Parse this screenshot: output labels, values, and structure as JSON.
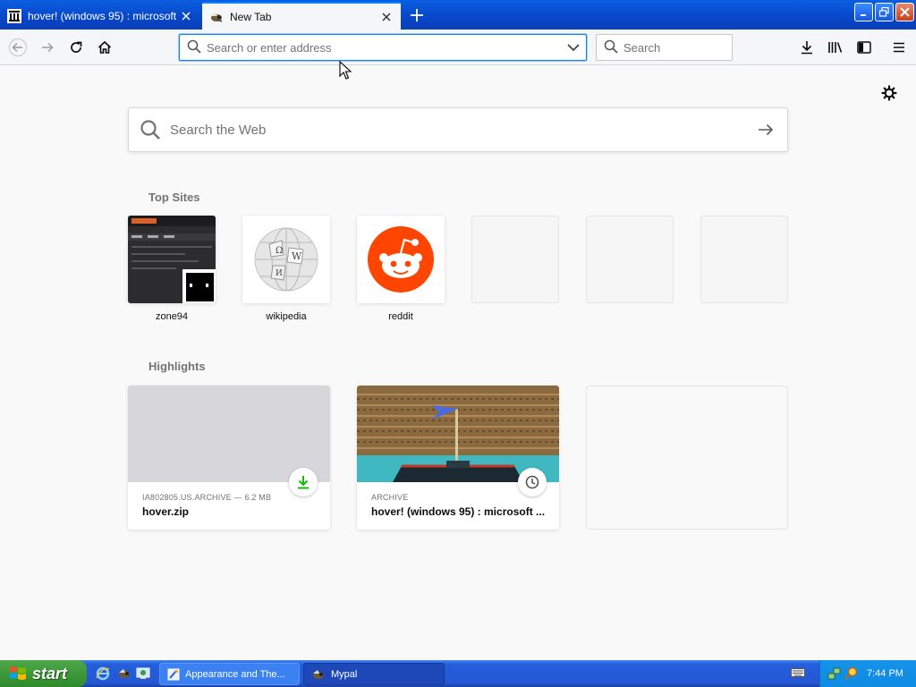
{
  "tabs": [
    {
      "title": "hover! (windows 95) : microsoft :",
      "icon": "archive-icon",
      "active": false
    },
    {
      "title": "New Tab",
      "icon": "mypal-icon",
      "active": true
    }
  ],
  "window_controls": [
    "minimize",
    "maximize",
    "close"
  ],
  "navbar": {
    "url_placeholder": "Search or enter address",
    "url_value": "",
    "search_placeholder": "Search"
  },
  "newtab": {
    "web_search_placeholder": "Search the Web",
    "top_sites_title": "Top Sites",
    "highlights_title": "Highlights",
    "top_sites": [
      {
        "label": "zone94",
        "thumb": "screenshot"
      },
      {
        "label": "wikipedia",
        "thumb": "wikipedia-globe-icon"
      },
      {
        "label": "reddit",
        "thumb": "reddit-alien-icon"
      },
      {
        "label": "",
        "thumb": "empty"
      },
      {
        "label": "",
        "thumb": "empty"
      },
      {
        "label": "",
        "thumb": "empty"
      }
    ],
    "highlights": [
      {
        "context": "IA802805.US.ARCHIVE — 6.2 MB",
        "title": "hover.zip",
        "badge": "download-icon"
      },
      {
        "context": "ARCHIVE",
        "title": "hover! (windows 95) : microsoft ...",
        "badge": "history-clock-icon"
      },
      {
        "context": "",
        "title": "",
        "badge": ""
      }
    ]
  },
  "taskbar": {
    "start_label": "start",
    "tasks": [
      {
        "label": "Appearance and The...",
        "active": false
      },
      {
        "label": "Mypal",
        "active": true
      }
    ],
    "time": "7:44 PM"
  },
  "colors": {
    "accent": "#0a84ff",
    "reddit": "#ff4500",
    "download_green": "#12bc00",
    "xp_blue": "#245edb",
    "xp_green": "#3c9939"
  }
}
